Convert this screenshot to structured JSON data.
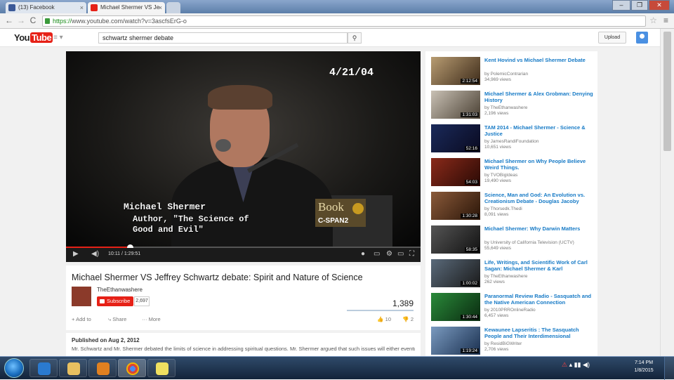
{
  "browser": {
    "tabs": [
      {
        "title": "(13) Facebook",
        "color": "#3b5998"
      },
      {
        "title": "Michael Shermer VS Je",
        "color": "#e62117"
      }
    ],
    "url_scheme": "https://",
    "url_rest": "www.youtube.com/watch?v=3ascfsErG-o"
  },
  "youtube": {
    "logo_you": "You",
    "logo_tube": "Tube",
    "search_query": "schwartz shermer debate",
    "upload_label": "Upload"
  },
  "player": {
    "osd_date": "4/21/04",
    "lower_third_name": "Michael Shermer",
    "lower_third_line1": "Author, \"The Science of",
    "lower_third_line2": "Good and Evil\"",
    "network_logo": "Book",
    "network_channel": "C-SPAN2",
    "timecode": "10:11 / 1:29:51",
    "progress_fraction": 0.18
  },
  "video": {
    "title": "Michael Shermer VS Jeffrey Schwartz debate: Spirit and Nature of Science",
    "channel": "TheEthanwashere",
    "subscribe_label": "Subscribe",
    "subscriber_count": "2,697",
    "view_count": "1,389",
    "add_to": "Add to",
    "share": "Share",
    "more": "More",
    "likes": "10",
    "dislikes": "2",
    "published": "Published on Aug 2, 2012",
    "description": "Mr. Schwartz and Mr. Shermer debated the limits of science in addressing spiritual questions. Mr. Shermer argued that such issues will either eventually be addressed using scientific thinking or will remain mysteries that science cannot penetrate. Going beyond"
  },
  "related": [
    {
      "title": "Kent Hovind vs Michael Shermer Debate",
      "by": "by PolemicContrarian",
      "views": "34,969 views",
      "duration": "2:12:54",
      "c1": "#b89c72",
      "c2": "#3d2b1a"
    },
    {
      "title": "Michael Shermer & Alex Grobman: Denying History",
      "by": "by TheEthanwashere",
      "views": "2,196 views",
      "duration": "1:31:03",
      "c1": "#c9c1b5",
      "c2": "#4a4033"
    },
    {
      "title": "TAM 2014 - Michael Shermer - Science & Justice",
      "by": "by JamesRandiFoundation",
      "views": "10,651 views",
      "duration": "52:16",
      "c1": "#1a2a5a",
      "c2": "#0a0a20"
    },
    {
      "title": "Michael Shermer on Why People Believe Weird Things.",
      "by": "by TVOBigIdeas",
      "views": "19,490 views",
      "duration": "54:03",
      "c1": "#8a2a1a",
      "c2": "#2a0a05"
    },
    {
      "title": "Science, Man and God: An Evolution vs. Creationism Debate - Douglas Jacoby",
      "by": "by Thorsedk.Thedi",
      "views": "8,091 views",
      "duration": "1:30:28",
      "c1": "#8a5a3a",
      "c2": "#2a1508"
    },
    {
      "title": "Michael Shermer: Why Darwin Matters",
      "by": "by University of California Television (UCTV)",
      "views": "55,649 views",
      "duration": "58:35",
      "c1": "#555555",
      "c2": "#111111"
    },
    {
      "title": "Life, Writings, and Scientific Work of Carl Sagan: Michael Shermer & Karl",
      "by": "by TheEthanwashere",
      "views": "262 views",
      "duration": "1:00:02",
      "c1": "#5a6a7a",
      "c2": "#1a1a1a"
    },
    {
      "title": "Paranormal Review Radio - Sasquatch and the Native American Connection",
      "by": "by 2010PRROnlineRadio",
      "views": "6,457 views",
      "duration": "1:30:44",
      "c1": "#2a8a3a",
      "c2": "#0a2a10"
    },
    {
      "title": "Kewaunee Lapseritis : The Sasquatch People and Their Interdimensional",
      "by": "by ResidBiGWriter",
      "views": "2,706 views",
      "duration": "1:19:24",
      "c1": "#7a9abf",
      "c2": "#1a3050"
    }
  ],
  "taskbar": {
    "clock_time": "7:14 PM",
    "clock_date": "1/8/2015"
  }
}
